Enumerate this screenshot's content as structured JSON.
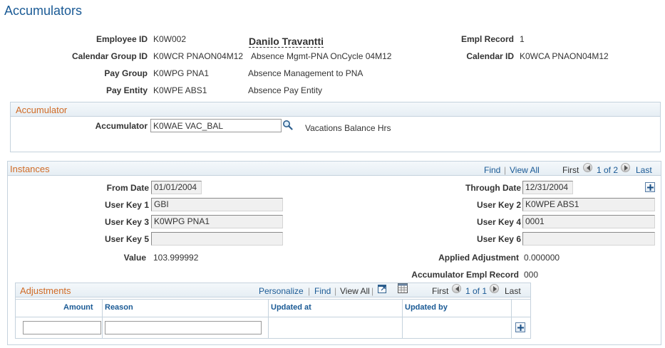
{
  "page": {
    "title": "Accumulators"
  },
  "header": {
    "employee_id": {
      "label": "Employee ID",
      "value": "K0W002"
    },
    "employee_name": "Danilo Travantti",
    "empl_record": {
      "label": "Empl Record",
      "value": "1"
    },
    "calendar_group_id": {
      "label": "Calendar Group ID",
      "value": "K0WCR PNAON04M12",
      "desc": "Absence Mgmt-PNA OnCycle 04M12"
    },
    "calendar_id": {
      "label": "Calendar ID",
      "value": "K0WCA PNAON04M12"
    },
    "pay_group": {
      "label": "Pay Group",
      "value": "K0WPG PNA1",
      "desc": "Absence Management to PNA"
    },
    "pay_entity": {
      "label": "Pay Entity",
      "value": "K0WPE ABS1",
      "desc": "Absence Pay Entity"
    }
  },
  "accumulator_section": {
    "title": "Accumulator",
    "accumulator": {
      "label": "Accumulator",
      "value": "K0WAE VAC_BAL",
      "desc": "Vacations Balance Hrs"
    }
  },
  "instances": {
    "title": "Instances",
    "nav": {
      "find": "Find",
      "separator": "|",
      "view_all": "View All",
      "first": "First",
      "range": "1 of 2",
      "last": "Last"
    },
    "from_date": {
      "label": "From Date",
      "value": "01/01/2004"
    },
    "through_date": {
      "label": "Through Date",
      "value": "12/31/2004"
    },
    "user_key_1": {
      "label": "User Key 1",
      "value": "GBI"
    },
    "user_key_2": {
      "label": "User Key 2",
      "value": "K0WPE ABS1"
    },
    "user_key_3": {
      "label": "User Key 3",
      "value": "K0WPG PNA1"
    },
    "user_key_4": {
      "label": "User Key 4",
      "value": "0001"
    },
    "user_key_5": {
      "label": "User Key 5",
      "value": ""
    },
    "user_key_6": {
      "label": "User Key 6",
      "value": ""
    },
    "value": {
      "label": "Value",
      "value": "103.999992"
    },
    "applied_adjustment": {
      "label": "Applied Adjustment",
      "value": "0.000000"
    },
    "accumulator_empl_record": {
      "label": "Accumulator Empl Record",
      "value": "000"
    }
  },
  "adjustments": {
    "title": "Adjustments",
    "nav": {
      "personalize": "Personalize",
      "find": "Find",
      "view_all": "View All",
      "separator": "|",
      "first": "First",
      "range": "1 of 1",
      "last": "Last"
    },
    "columns": [
      "Amount",
      "Reason",
      "Updated at",
      "Updated by"
    ],
    "rows": [
      {
        "amount": "",
        "reason": "",
        "updated_at": "",
        "updated_by": ""
      }
    ]
  },
  "icons": {
    "lookup": "magnifier-icon",
    "add": "plus-icon",
    "prev": "left-arrow-icon",
    "next": "right-arrow-icon",
    "zoom": "zoom-window-icon",
    "download": "spreadsheet-icon"
  },
  "colors": {
    "title": "#1a5a95",
    "section_title": "#d06b26",
    "link": "#1a5a95",
    "border": "#c5d2dd"
  }
}
